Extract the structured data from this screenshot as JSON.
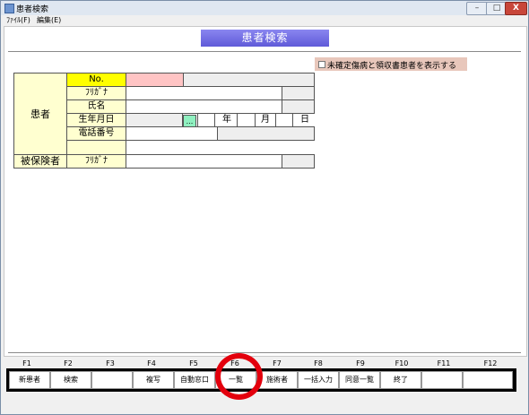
{
  "window": {
    "title": "患者検索",
    "min": "–",
    "max": "□",
    "close": "X"
  },
  "menu": {
    "file": "ﾌｧｲﾙ(F)",
    "edit": "編集(E)"
  },
  "header": {
    "title": "患者検索"
  },
  "toggle": {
    "label": "未確定傷病と領収書患者を表示する",
    "checked": false
  },
  "form": {
    "group_patient": "患者",
    "group_insured": "被保険者",
    "labels": {
      "no": "No.",
      "kana": "ﾌﾘｶﾞﾅ",
      "name": "氏名",
      "birth": "生年月日",
      "phone": "電話番号",
      "insured_kana": "ﾌﾘｶﾞﾅ"
    },
    "birth": {
      "picker": "...",
      "year_unit": "年",
      "month_unit": "月",
      "day_unit": "日"
    }
  },
  "fkeys": [
    "F1",
    "F2",
    "F3",
    "F4",
    "F5",
    "F6",
    "F7",
    "F8",
    "F9",
    "F10",
    "F11",
    "F12"
  ],
  "buttons": [
    "新患者",
    "検索",
    "",
    "複写",
    "自動窓口",
    "一覧",
    "施術者",
    "一括入力",
    "同意一覧",
    "終了",
    "",
    ""
  ],
  "colors": {
    "highlight": "#e3000d",
    "header": "#6f6ae0"
  }
}
